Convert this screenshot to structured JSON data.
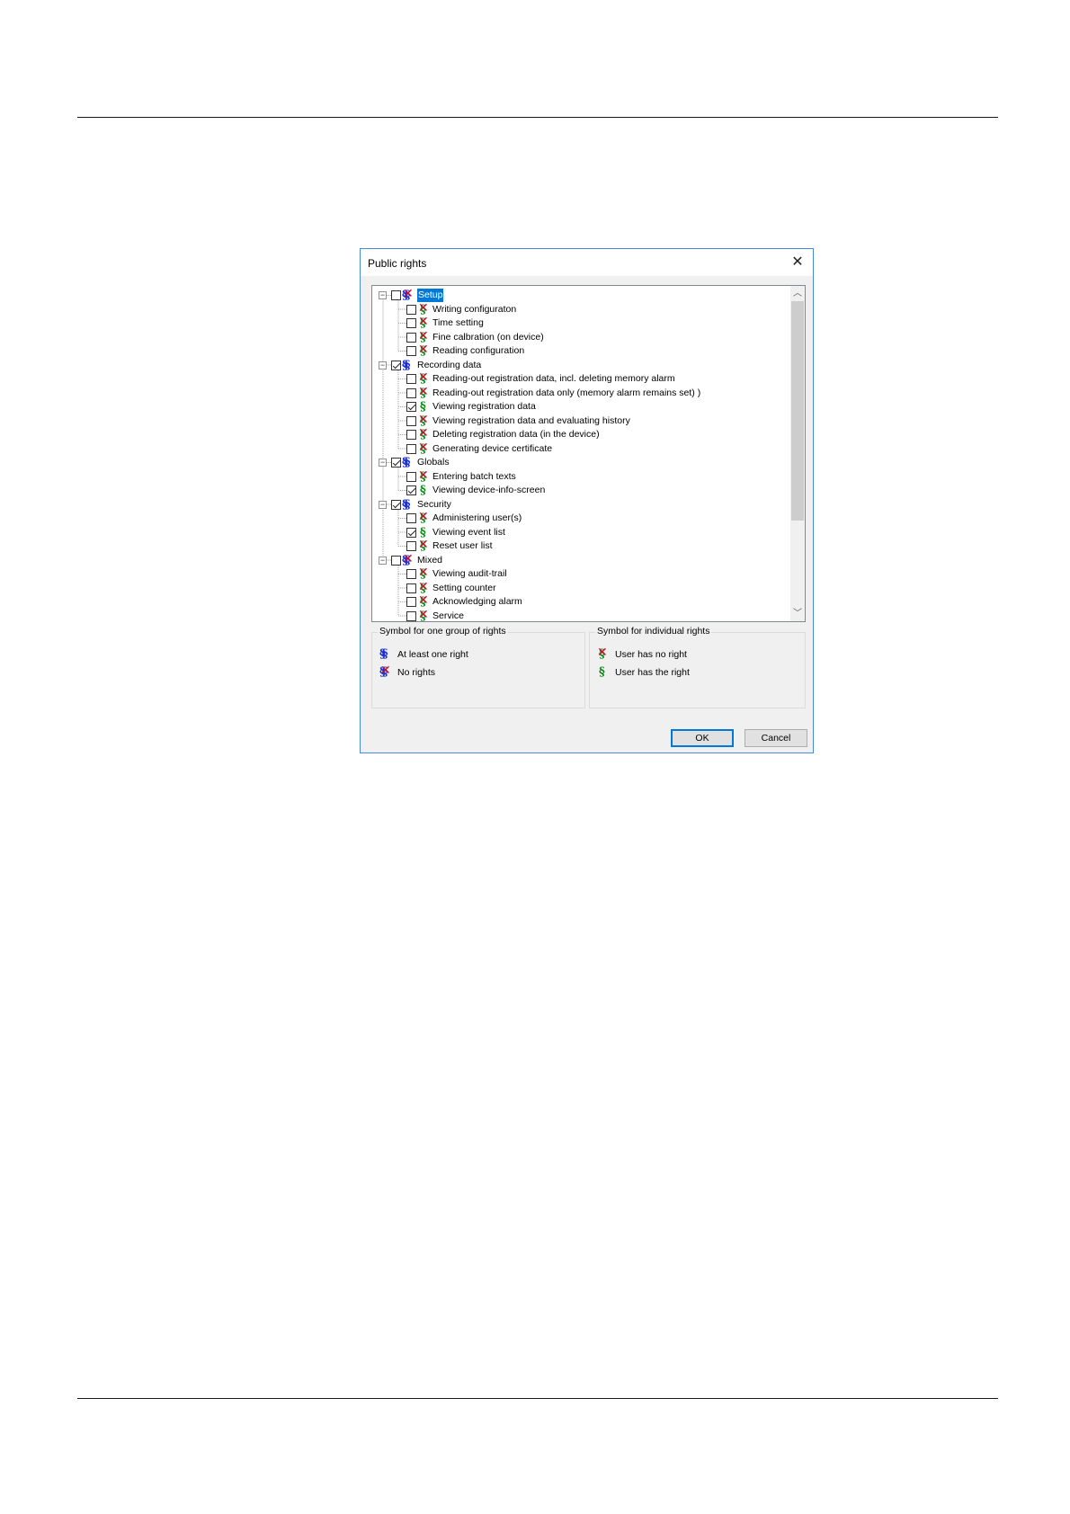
{
  "dialog": {
    "title": "Public rights",
    "ok_label": "OK",
    "cancel_label": "Cancel"
  },
  "icons": {
    "group_at_least_one": "double-section-blue-icon",
    "group_no_rights": "double-section-crossed-icon",
    "right_granted": "section-green-icon",
    "right_denied": "section-crossed-icon",
    "close": "close-icon",
    "expand": "collapse-minus-icon"
  },
  "colors": {
    "selection": "#0078d7",
    "group_icon": "#1a2fd0",
    "granted_icon": "#0a8a12",
    "denied_cross": "#c8102e",
    "dialog_border": "#4a8ad8"
  },
  "tree": {
    "groups": [
      {
        "label": "Setup",
        "checked": false,
        "has_rights": false,
        "selected": true,
        "items": [
          {
            "label": "Writing configuraton",
            "checked": false
          },
          {
            "label": "Time setting",
            "checked": false
          },
          {
            "label": "Fine calbration (on device)",
            "checked": false
          },
          {
            "label": "Reading configuration",
            "checked": false
          }
        ]
      },
      {
        "label": "Recording data",
        "checked": true,
        "has_rights": true,
        "selected": false,
        "items": [
          {
            "label": "Reading-out registration data, incl. deleting memory alarm",
            "checked": false
          },
          {
            "label": "Reading-out registration data only (memory alarm remains set) )",
            "checked": false
          },
          {
            "label": "Viewing registration data",
            "checked": true
          },
          {
            "label": "Viewing registration data and evaluating history",
            "checked": false
          },
          {
            "label": "Deleting registration data (in the device)",
            "checked": false
          },
          {
            "label": "Generating device certificate",
            "checked": false
          }
        ]
      },
      {
        "label": "Globals",
        "checked": true,
        "has_rights": true,
        "selected": false,
        "items": [
          {
            "label": "Entering batch texts",
            "checked": false
          },
          {
            "label": "Viewing device-info-screen",
            "checked": true
          }
        ]
      },
      {
        "label": "Security",
        "checked": true,
        "has_rights": true,
        "selected": false,
        "items": [
          {
            "label": "Administering user(s)",
            "checked": false
          },
          {
            "label": "Viewing event list",
            "checked": true
          },
          {
            "label": "Reset user list",
            "checked": false
          }
        ]
      },
      {
        "label": "Mixed",
        "checked": false,
        "has_rights": false,
        "selected": false,
        "items": [
          {
            "label": "Viewing audit-trail",
            "checked": false
          },
          {
            "label": "Setting counter",
            "checked": false
          },
          {
            "label": "Acknowledging alarm",
            "checked": false
          },
          {
            "label": "Service",
            "checked": false
          }
        ]
      }
    ],
    "scroll_fraction_visible": 0.72
  },
  "legend_groups": {
    "title": "Symbol for one group of rights",
    "at_least_one": "At least one right",
    "no_rights": "No rights"
  },
  "legend_individual": {
    "title": "Symbol for individual rights",
    "no_right": "User has no right",
    "has_right": "User has the right"
  }
}
